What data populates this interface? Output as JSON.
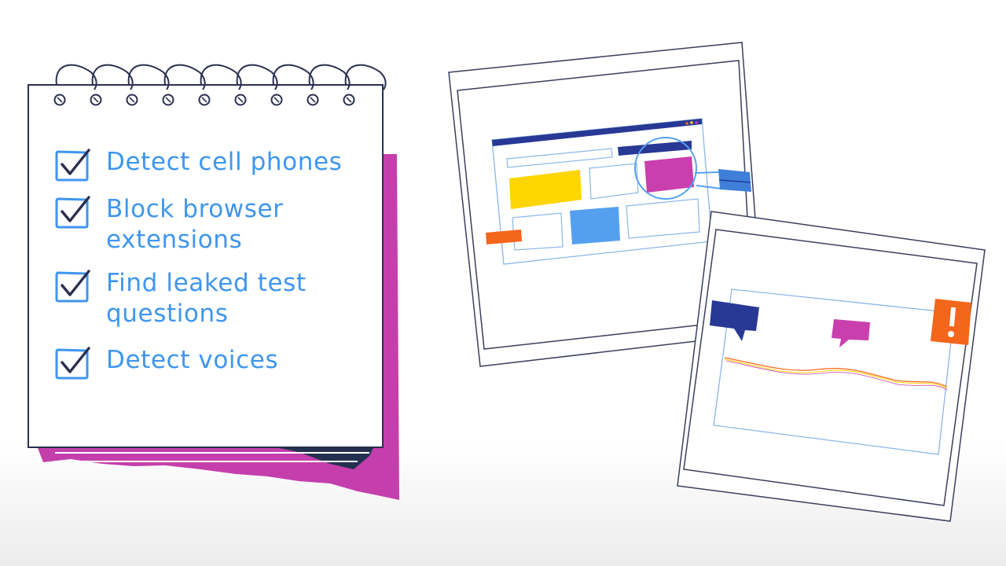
{
  "notepad": {
    "tasks": [
      {
        "label": "Detect cell phones",
        "checked": true
      },
      {
        "label": "Block browser\nextensions",
        "checked": true
      },
      {
        "label": "Find leaked test\nquestions",
        "checked": true
      },
      {
        "label": "Detect voices",
        "checked": true
      }
    ]
  },
  "colors": {
    "accent_blue": "#3f96ee",
    "navy": "#2a2f4e",
    "magenta": "#c93fae",
    "yellow": "#fdd500",
    "orange": "#f4661b",
    "light_blue": "#55a0ee",
    "dark_blue": "#283895"
  },
  "icons": {
    "checkbox": "checkbox-checked-icon",
    "warning": "exclamation-icon",
    "chat": "speech-bubble-icon",
    "magnifier": "magnifier-icon"
  }
}
